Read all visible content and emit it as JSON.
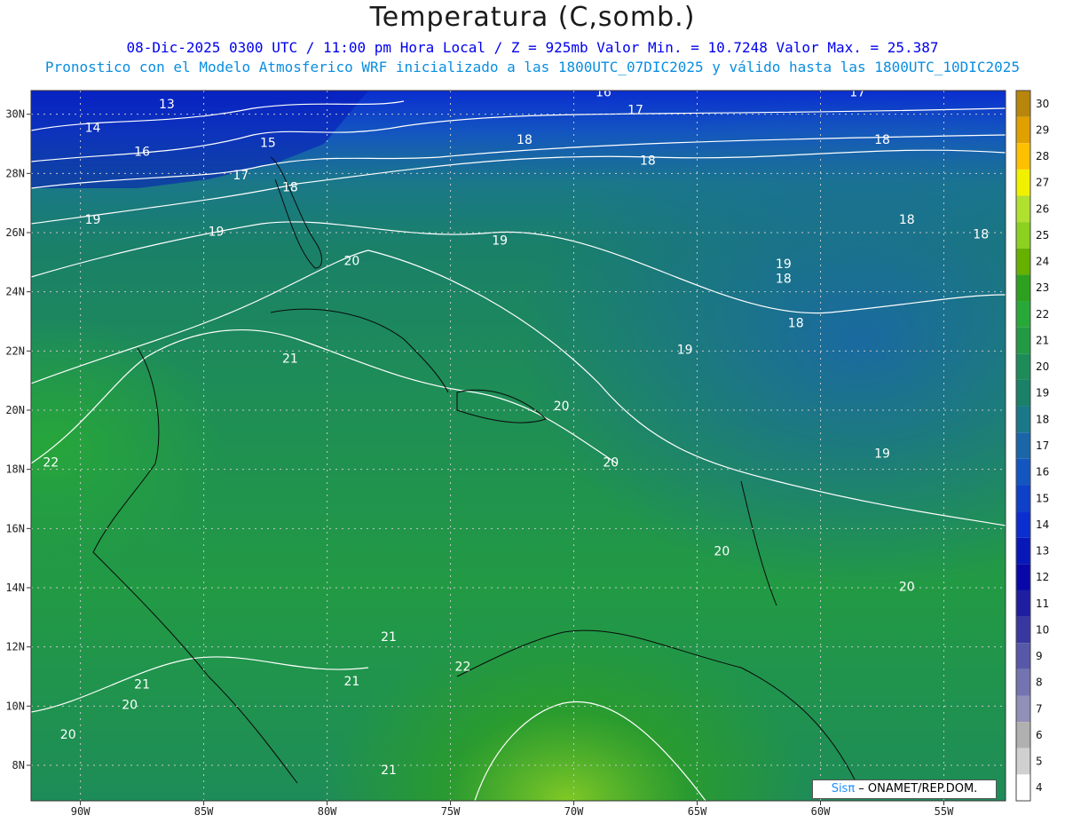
{
  "header": {
    "title": "Temperatura (C,somb.)",
    "subtitle_line1": "08-Dic-2025  0300 UTC / 11:00 pm Hora Local / Z = 925mb    Valor Min. = 10.7248  Valor Max. = 25.387",
    "subtitle_line2": "Pronostico con el Modelo Atmosferico WRF inicializado a las 1800UTC_07DIC2025 y válido hasta las  1800UTC_10DIC2025"
  },
  "map": {
    "lon_range": [
      -92,
      -52.5
    ],
    "lat_range": [
      6.8,
      30.8
    ],
    "lat_ticks": [
      "30N",
      "28N",
      "26N",
      "24N",
      "22N",
      "20N",
      "18N",
      "16N",
      "14N",
      "12N",
      "10N",
      "8N"
    ],
    "lon_ticks": [
      "90W",
      "85W",
      "80W",
      "75W",
      "70W",
      "65W",
      "60W",
      "55W"
    ],
    "contour_labels": [
      {
        "text": "13",
        "lon": -86.5,
        "lat": 30.2
      },
      {
        "text": "14",
        "lon": -89.5,
        "lat": 29.4
      },
      {
        "text": "15",
        "lon": -82.4,
        "lat": 28.9
      },
      {
        "text": "16",
        "lon": -87.5,
        "lat": 28.6
      },
      {
        "text": "17",
        "lon": -83.5,
        "lat": 27.8
      },
      {
        "text": "18",
        "lon": -81.5,
        "lat": 27.4
      },
      {
        "text": "16",
        "lon": -68.8,
        "lat": 30.6
      },
      {
        "text": "17",
        "lon": -67.5,
        "lat": 30.0
      },
      {
        "text": "18",
        "lon": -72.0,
        "lat": 29.0
      },
      {
        "text": "18",
        "lon": -67.0,
        "lat": 28.3
      },
      {
        "text": "17",
        "lon": -58.5,
        "lat": 30.6
      },
      {
        "text": "18",
        "lon": -57.5,
        "lat": 29.0
      },
      {
        "text": "19",
        "lon": -89.5,
        "lat": 26.3
      },
      {
        "text": "19",
        "lon": -84.5,
        "lat": 25.9
      },
      {
        "text": "20",
        "lon": -79.0,
        "lat": 24.9
      },
      {
        "text": "19",
        "lon": -73.0,
        "lat": 25.6
      },
      {
        "text": "18",
        "lon": -56.5,
        "lat": 26.3
      },
      {
        "text": "18",
        "lon": -53.5,
        "lat": 25.8
      },
      {
        "text": "19",
        "lon": -61.5,
        "lat": 24.8
      },
      {
        "text": "18",
        "lon": -61.5,
        "lat": 24.3
      },
      {
        "text": "18",
        "lon": -61.0,
        "lat": 22.8
      },
      {
        "text": "19",
        "lon": -65.5,
        "lat": 21.9
      },
      {
        "text": "21",
        "lon": -81.5,
        "lat": 21.6
      },
      {
        "text": "20",
        "lon": -70.5,
        "lat": 20.0
      },
      {
        "text": "20",
        "lon": -68.5,
        "lat": 18.1
      },
      {
        "text": "19",
        "lon": -57.5,
        "lat": 18.4
      },
      {
        "text": "22",
        "lon": -91.2,
        "lat": 18.1
      },
      {
        "text": "20",
        "lon": -64.0,
        "lat": 15.1
      },
      {
        "text": "20",
        "lon": -56.5,
        "lat": 13.9
      },
      {
        "text": "21",
        "lon": -77.5,
        "lat": 12.2
      },
      {
        "text": "22",
        "lon": -74.5,
        "lat": 11.2
      },
      {
        "text": "21",
        "lon": -87.5,
        "lat": 10.6
      },
      {
        "text": "21",
        "lon": -79.0,
        "lat": 10.7
      },
      {
        "text": "20",
        "lon": -88.0,
        "lat": 9.9
      },
      {
        "text": "20",
        "lon": -90.5,
        "lat": 8.9
      },
      {
        "text": "21",
        "lon": -77.5,
        "lat": 7.7
      }
    ],
    "credit_brand": "Sisπ",
    "credit_text": " – ONAMET/REP.DOM."
  },
  "colorbar": {
    "labels": [
      "30",
      "29",
      "28",
      "27",
      "26",
      "25",
      "24",
      "23",
      "22",
      "21",
      "20",
      "19",
      "18",
      "17",
      "16",
      "15",
      "14",
      "13",
      "12",
      "11",
      "10",
      "9",
      "8",
      "7",
      "6",
      "5",
      "4"
    ],
    "colors": [
      "#b8860b",
      "#e0a000",
      "#ffc000",
      "#f0f000",
      "#b0e030",
      "#8cd020",
      "#66b000",
      "#2ea020",
      "#28a838",
      "#229a44",
      "#1e8c58",
      "#1a8068",
      "#1a7888",
      "#1a66a8",
      "#1456c0",
      "#0e40c8",
      "#0a2ed0",
      "#0818b8",
      "#0808a8",
      "#1e1ea0",
      "#3838a0",
      "#5858a8",
      "#7474b0",
      "#9090b8",
      "#b0b0b0",
      "#d0d0d0",
      "#ffffff"
    ]
  }
}
